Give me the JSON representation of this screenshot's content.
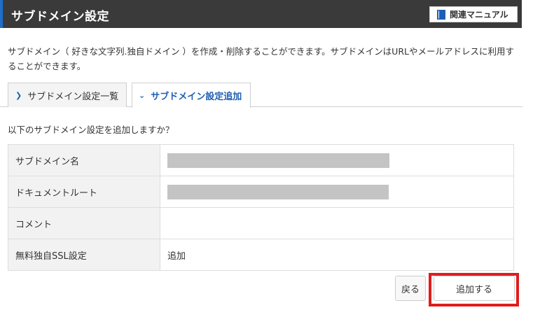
{
  "header": {
    "title": "サブドメイン設定",
    "manual_label": "関連マニュアル",
    "manual_icon": "book-icon",
    "accent_color": "#1e6ecb"
  },
  "description": "サブドメイン（ 好きな文字列.独自ドメイン ）を作成・削除することができます。サブドメインはURLやメールアドレスに利用することができます。",
  "tabs": [
    {
      "label": "サブドメイン設定一覧",
      "icon": "chevron-right-icon",
      "active": false
    },
    {
      "label": "サブドメイン設定追加",
      "icon": "chevron-down-icon",
      "active": true
    }
  ],
  "confirm_question": "以下のサブドメイン設定を追加しますか？",
  "table": {
    "rows": [
      {
        "label": "サブドメイン名",
        "value": ""
      },
      {
        "label": "ドキュメントルート",
        "value": ""
      },
      {
        "label": "コメント",
        "value": ""
      },
      {
        "label": "無料独自SSL設定",
        "value": "追加"
      }
    ]
  },
  "buttons": {
    "back_label": "戻る",
    "add_label": "追加する"
  },
  "highlight_color": "#e01d1d"
}
